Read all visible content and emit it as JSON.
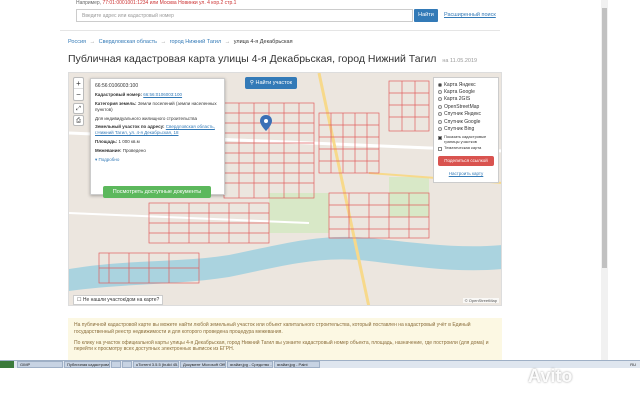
{
  "top": {
    "example_prefix": "Например,",
    "example_text": "77:01:0001001:1234 или Москва Новинки ул. 4 кор.2 стр.1",
    "search_placeholder": "Введите адрес или кадастровый номер",
    "search_button": "Найти",
    "advanced_link": "Расширенный поиск"
  },
  "breadcrumb": {
    "items": [
      "Россия",
      "Свердловская область",
      "город Нижний Тагил"
    ],
    "separator": "→",
    "current": "улица 4-я Декабрьская"
  },
  "page": {
    "title": "Публичная кадастровая карта улицы 4-я Декабрьская, город Нижний Тагил",
    "date": "на 11.05.2019"
  },
  "map": {
    "zoom_in": "+",
    "zoom_out": "−",
    "find_button": "Найти участок",
    "not_found": "Не нашли участок/дом на карте?",
    "attribution": "© OpenStreetMap",
    "popup": {
      "id": "66:56:0106003:100",
      "cad_label": "Кадастровый номер:",
      "cad_value": "66:56:0106003:100",
      "cat_label": "Категория земель:",
      "cat_value": "Земли поселений (земли населенных пунктов)",
      "use_value": "Для индивидуального жилищного строительства",
      "addr_label": "Земельный участок по адресу:",
      "addr_value": "Свердловская область, г.Нижний Тагил, ул. 4-я Декабрьская, 18",
      "area_label": "Площадь:",
      "area_value": "1 000 кв.м",
      "lock_label": "Межевание:",
      "lock_value": "Проведено",
      "more": "Подробно",
      "docs_button": "Посмотреть доступные документы"
    },
    "layers": {
      "options": [
        "Карта Яндекс",
        "Карта Google",
        "Карта 2GIS",
        "OpenStreetMap",
        "Спутник Яндекс",
        "Спутник Google",
        "Спутник Bing"
      ],
      "selected": 0,
      "check1": "Показать кадастровые границы участков",
      "check2": "Тематическая карта",
      "share": "Поделиться ссылкой",
      "setup": "Настроить карту"
    }
  },
  "info": {
    "p1": "На публичной кадастровой карте вы можете найти любой земельный участок или объект капитального строительства, который поставлен на кадастровый учёт в Единый государственный реестр недвижимости и для которого проведена процедура межевания.",
    "p2": "По клику на участок официальной карты улицы 4-я Декабрьская, город Нижний Тагил вы узнаете кадастровый номер объекта, площадь, назначение, где построили (для дома) и перейти к просмотру всех доступных электронных выписок из ЕГРН."
  },
  "taskbar": {
    "items": [
      "GIMP",
      "Публичная кадастровая...",
      "",
      "",
      "uTorrent 3.5.5 (build 45...",
      "Документ Microsoft Offi...",
      "ягайат.jpg - Средство ...",
      "ягайат.jpg - Paint"
    ],
    "tray": "RU"
  },
  "watermark": "Avito"
}
